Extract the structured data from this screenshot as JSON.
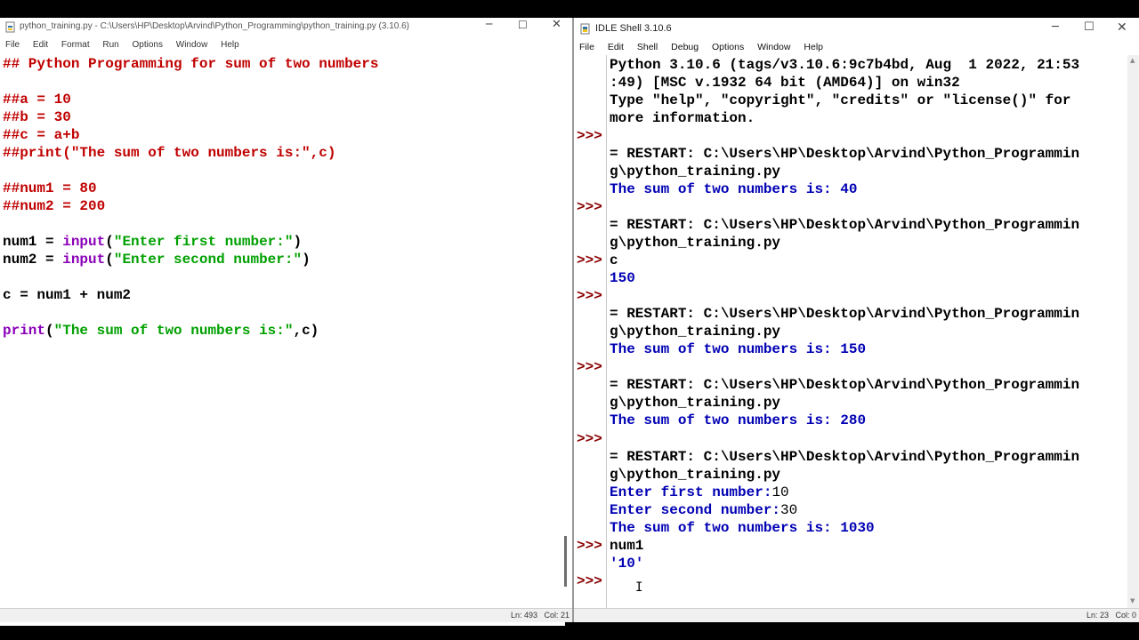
{
  "editor": {
    "title": "python_training.py - C:\\Users\\HP\\Desktop\\Arvind\\Python_Programming\\python_training.py (3.10.6)",
    "menu": [
      "File",
      "Edit",
      "Format",
      "Run",
      "Options",
      "Window",
      "Help"
    ],
    "lines": {
      "l1": "## Python Programming for sum of two numbers",
      "l2": "##a = 10",
      "l3": "##b = 30",
      "l4": "##c = a+b",
      "l5": "##print(\"The sum of two numbers is:\",c)",
      "l6": "##num1 = 80",
      "l7": "##num2 = 200",
      "l8a": "num1 = ",
      "l8b": "input",
      "l8c": "(",
      "l8d": "\"Enter first number:\"",
      "l8e": ")",
      "l9a": "num2 = ",
      "l9b": "input",
      "l9c": "(",
      "l9d": "\"Enter second number:\"",
      "l9e": ")",
      "l10": "c = num1 + num2",
      "l11a": "print",
      "l11b": "(",
      "l11c": "\"The sum of two numbers is:\"",
      "l11d": ",c)"
    },
    "status": "Ln: 493   Col: 21"
  },
  "shell": {
    "title": "IDLE Shell 3.10.6",
    "menu": [
      "File",
      "Edit",
      "Shell",
      "Debug",
      "Options",
      "Window",
      "Help"
    ],
    "prompt": ">>>",
    "lines": {
      "s1": "Python 3.10.6 (tags/v3.10.6:9c7b4bd, Aug  1 2022, 21:53",
      "s2": ":49) [MSC v.1932 64 bit (AMD64)] on win32",
      "s3": "Type \"help\", \"copyright\", \"credits\" or \"license()\" for",
      "s4": "more information.",
      "s5": "= RESTART: C:\\Users\\HP\\Desktop\\Arvind\\Python_Programmin",
      "s6": "g\\python_training.py",
      "s7": "The sum of two numbers is: 40",
      "s8": "= RESTART: C:\\Users\\HP\\Desktop\\Arvind\\Python_Programmin",
      "s9": "g\\python_training.py",
      "s10": "c",
      "s11": "150",
      "s12": "= RESTART: C:\\Users\\HP\\Desktop\\Arvind\\Python_Programmin",
      "s13": "g\\python_training.py",
      "s14": "The sum of two numbers is: 150",
      "s15": "= RESTART: C:\\Users\\HP\\Desktop\\Arvind\\Python_Programmin",
      "s16": "g\\python_training.py",
      "s17": "The sum of two numbers is: 280",
      "s18": "= RESTART: C:\\Users\\HP\\Desktop\\Arvind\\Python_Programmin",
      "s19": "g\\python_training.py",
      "s20a": "Enter first number:",
      "s20b": "10",
      "s21a": "Enter second number:",
      "s21b": "30",
      "s22": "The sum of two numbers is: 1030",
      "s23": "num1",
      "s24": "'10'"
    },
    "status": "Ln: 23   Col: 0"
  },
  "colors": {
    "comment": "#c00000",
    "keyword": "#8a00b8",
    "string": "#00a000",
    "output": "#0000b4",
    "prompt": "#8b0000"
  },
  "icons": [
    "python-file-icon",
    "idle-icon",
    "minimize-icon",
    "maximize-icon",
    "close-icon",
    "text-cursor-icon"
  ]
}
